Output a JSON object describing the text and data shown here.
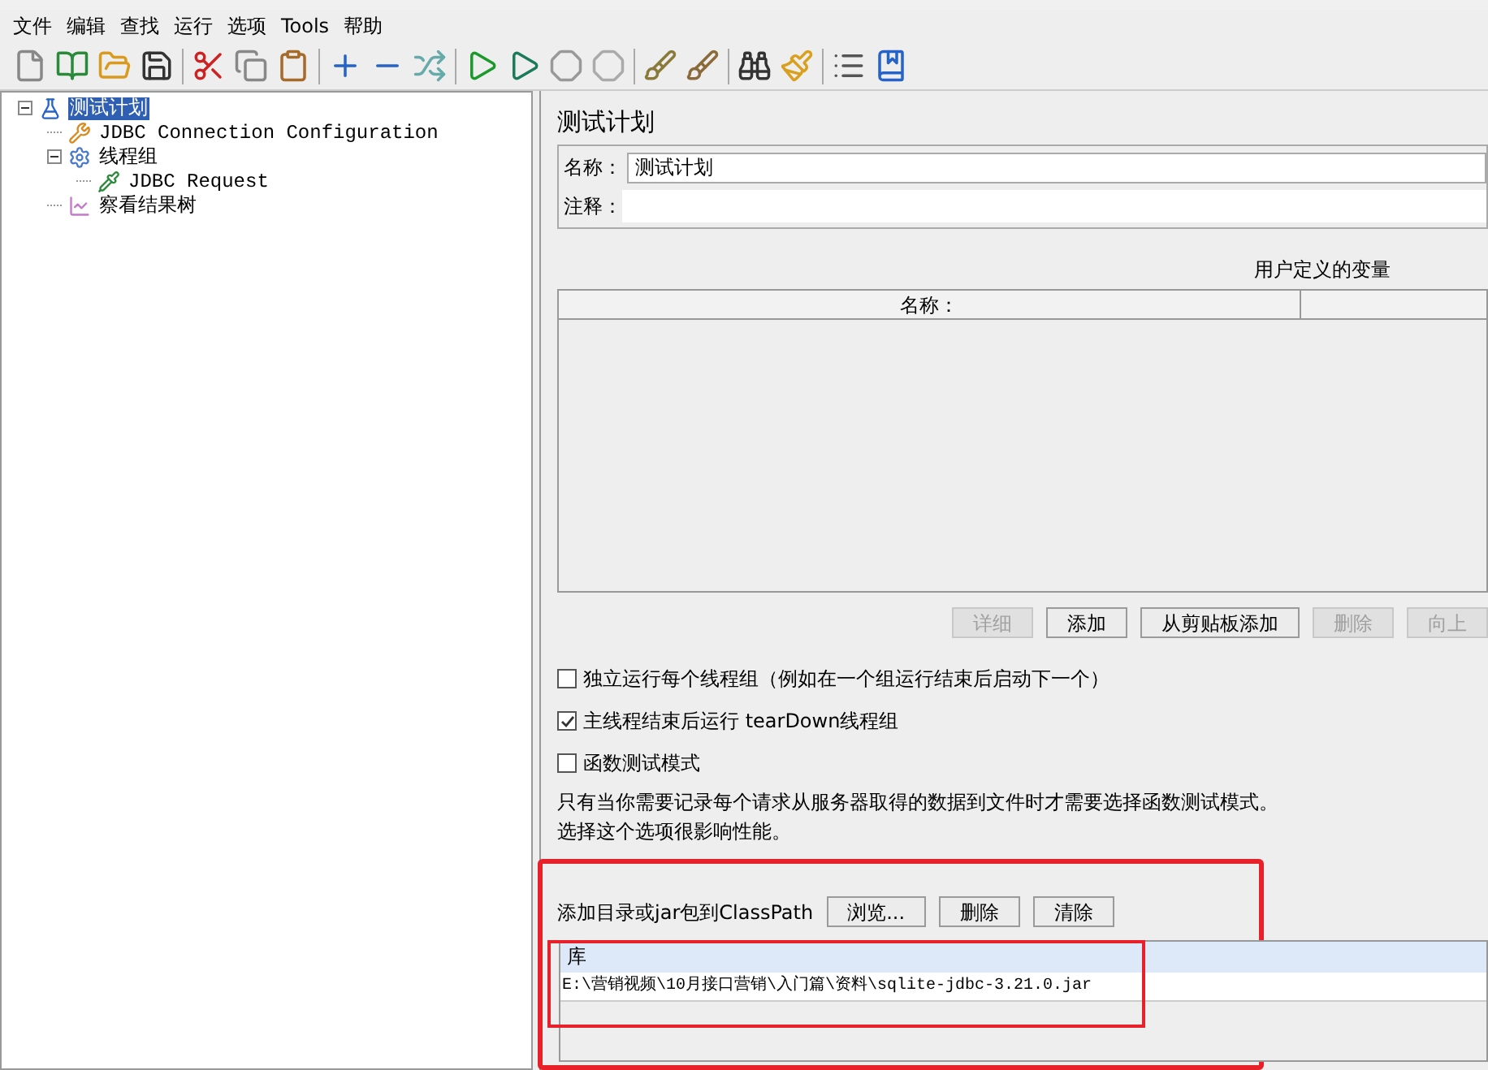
{
  "menu": [
    {
      "label": "文件"
    },
    {
      "label": "编辑"
    },
    {
      "label": "查找"
    },
    {
      "label": "运行"
    },
    {
      "label": "选项"
    },
    {
      "label": "Tools"
    },
    {
      "label": "帮助"
    }
  ],
  "tree": [
    {
      "label": "测试计划",
      "kind": "plan",
      "selected": true,
      "expanded": true,
      "children": [
        {
          "label": "JDBC Connection Configuration",
          "kind": "config",
          "selected": false
        },
        {
          "label": "线程组",
          "kind": "group",
          "selected": false,
          "expanded": true,
          "children": [
            {
              "label": "JDBC Request",
              "kind": "sampler",
              "selected": false
            }
          ]
        },
        {
          "label": "察看结果树",
          "kind": "listener",
          "selected": false
        }
      ]
    }
  ],
  "panel": {
    "title": "测试计划",
    "name_label": "名称：",
    "name_value": "测试计划",
    "comment_label": "注释：",
    "variables": {
      "title": "用户定义的变量",
      "columns": [
        "名称："
      ],
      "buttons": [
        {
          "label": "详细",
          "disabled": true
        },
        {
          "label": "添加",
          "disabled": false
        },
        {
          "label": "从剪贴板添加",
          "disabled": false
        },
        {
          "label": "删除",
          "disabled": true
        },
        {
          "label": "向上",
          "disabled": true
        }
      ]
    },
    "options": [
      {
        "label": "独立运行每个线程组（例如在一个组运行结束后启动下一个）",
        "checked": false
      },
      {
        "label": "主线程结束后运行 tearDown线程组",
        "checked": true
      },
      {
        "label": "函数测试模式",
        "checked": false
      }
    ],
    "notes": [
      "只有当你需要记录每个请求从服务器取得的数据到文件时才需要选择函数测试模式。",
      "选择这个选项很影响性能。"
    ],
    "classpath": {
      "label": "添加目录或jar包到ClassPath",
      "buttons": [
        {
          "label": "浏览..."
        },
        {
          "label": "删除"
        },
        {
          "label": "清除"
        }
      ],
      "column": "库",
      "rows": [
        "E:\\营销视频\\10月接口营销\\入门篇\\资料\\sqlite-jdbc-3.21.0.jar"
      ]
    }
  }
}
